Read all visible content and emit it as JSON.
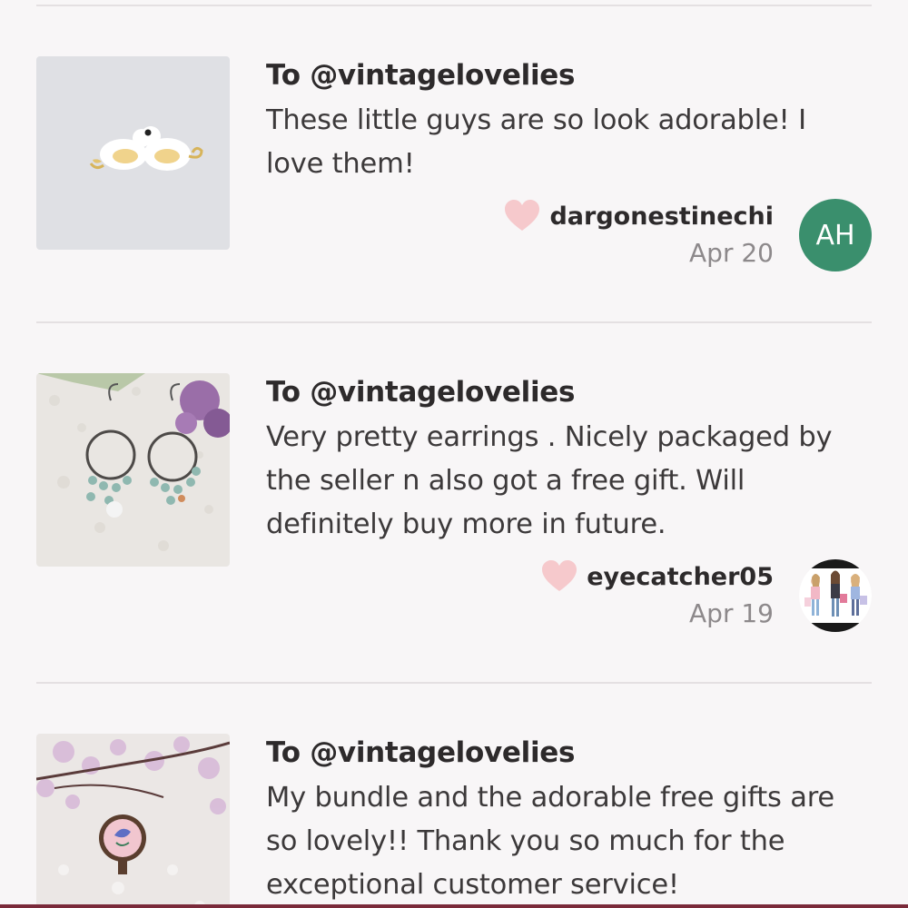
{
  "colors": {
    "background": "#f8f6f7",
    "heart": "#f6c9cc",
    "avatar_ah": "#3a8f6d",
    "divider": "#e4e0e2"
  },
  "reviews": [
    {
      "recipient": "To @vintagelovelies",
      "text": "These little guys are so look adorable! I love them!",
      "username": "dargonestinechi",
      "date": "Apr 20",
      "avatar_initials": "AH",
      "thumb_icon": "bird-earrings-photo",
      "heart_icon": "heart-icon"
    },
    {
      "recipient": "To @vintagelovelies",
      "text": "Very pretty earrings . Nicely packaged by the seller n also got a free gift. Will definitely buy more in future.",
      "username": "eyecatcher05",
      "date": "Apr 19",
      "avatar_image": "fashion-illustration-avatar",
      "thumb_icon": "chandelier-earrings-photo",
      "heart_icon": "heart-icon"
    },
    {
      "recipient": "To @vintagelovelies",
      "text": "My bundle and the adorable free gifts are so lovely!! Thank you so much for the exceptional customer service!",
      "thumb_icon": "flower-ring-photo"
    }
  ]
}
